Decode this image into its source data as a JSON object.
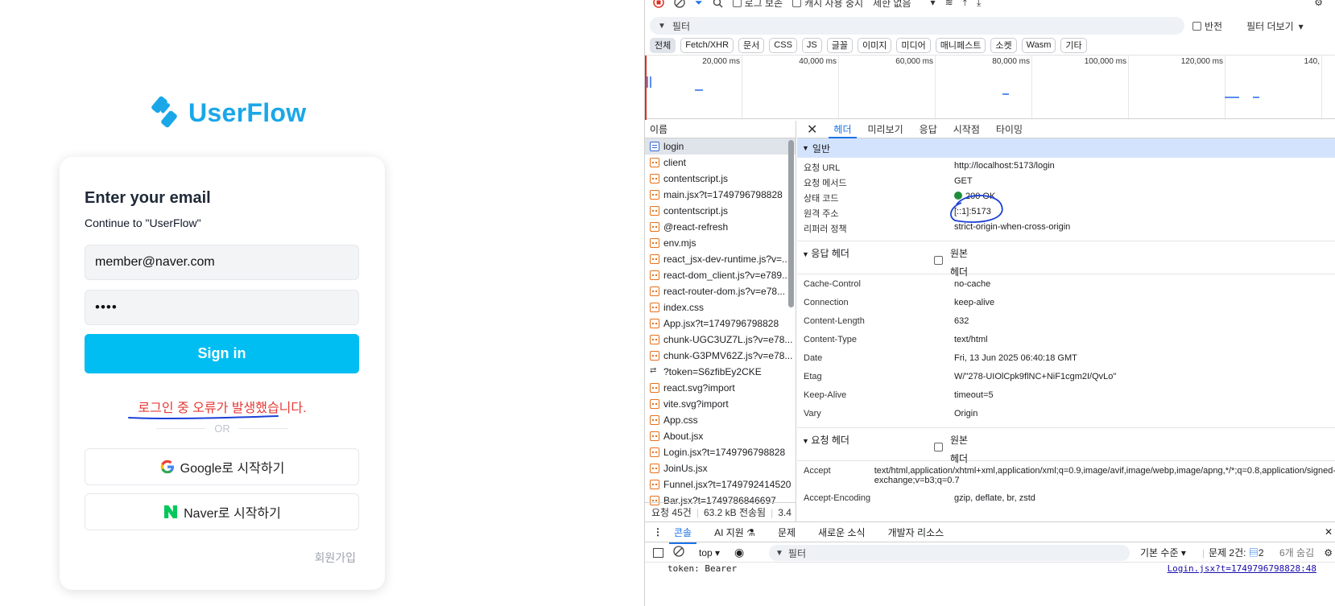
{
  "app": {
    "brand": "UserFlow",
    "title": "Enter your email",
    "subtitle": "Continue to \"UserFlow\"",
    "email_value": "member@naver.com",
    "password_mask": "••••",
    "signin_label": "Sign in",
    "error_message": "로그인 중 오류가 발생했습니다.",
    "or_label": "OR",
    "google_label": "Google로 시작하기",
    "naver_label": "Naver로 시작하기",
    "signup_label": "회원가입",
    "colors": {
      "brand": "#1aa7e8",
      "primary_button": "#00bdf2",
      "error": "#e53935",
      "naver": "#03c75a"
    }
  },
  "devtools": {
    "toolbar1": {
      "preserve_log": "로그 보존",
      "disable_cache": "캐시 사용 중지",
      "throttle": "제한 없음"
    },
    "filter_placeholder": "필터",
    "invert": "반전",
    "more_filters": "필터 더보기",
    "type_filters": [
      "전체",
      "Fetch/XHR",
      "문서",
      "CSS",
      "JS",
      "글꼴",
      "이미지",
      "미디어",
      "매니페스트",
      "소켓",
      "Wasm",
      "기타"
    ],
    "timeline_ticks": [
      "20,000 ms",
      "40,000 ms",
      "60,000 ms",
      "80,000 ms",
      "100,000 ms",
      "120,000 ms",
      "140,"
    ],
    "name_header": "이름",
    "requests": [
      {
        "name": "login",
        "type": "doc"
      },
      {
        "name": "client",
        "type": "script"
      },
      {
        "name": "contentscript.js",
        "type": "script"
      },
      {
        "name": "main.jsx?t=1749796798828",
        "type": "script"
      },
      {
        "name": "contentscript.js",
        "type": "script"
      },
      {
        "name": "@react-refresh",
        "type": "script"
      },
      {
        "name": "env.mjs",
        "type": "script"
      },
      {
        "name": "react_jsx-dev-runtime.js?v=...",
        "type": "script"
      },
      {
        "name": "react-dom_client.js?v=e789...",
        "type": "script"
      },
      {
        "name": "react-router-dom.js?v=e78...",
        "type": "script"
      },
      {
        "name": "index.css",
        "type": "script"
      },
      {
        "name": "App.jsx?t=1749796798828",
        "type": "script"
      },
      {
        "name": "chunk-UGC3UZ7L.js?v=e78...",
        "type": "script"
      },
      {
        "name": "chunk-G3PMV62Z.js?v=e78...",
        "type": "script"
      },
      {
        "name": "?token=S6zfibEy2CKE",
        "type": "ws"
      },
      {
        "name": "react.svg?import",
        "type": "script"
      },
      {
        "name": "vite.svg?import",
        "type": "script"
      },
      {
        "name": "App.css",
        "type": "script"
      },
      {
        "name": "About.jsx",
        "type": "script"
      },
      {
        "name": "Login.jsx?t=1749796798828",
        "type": "script"
      },
      {
        "name": "JoinUs.jsx",
        "type": "script"
      },
      {
        "name": "Funnel.jsx?t=1749792414520",
        "type": "script"
      },
      {
        "name": "Bar.jsx?t=1749786846697",
        "type": "script"
      }
    ],
    "status_bar": {
      "requests": "요청 45건",
      "transferred": "63.2 kB 전송됨",
      "resources": "3.4"
    },
    "detail_tabs": [
      "헤더",
      "미리보기",
      "응답",
      "시작점",
      "타이밍"
    ],
    "general_title": "일반",
    "general": [
      {
        "k": "요청 URL",
        "v": "http://localhost:5173/login"
      },
      {
        "k": "요청 메서드",
        "v": "GET"
      },
      {
        "k": "상태 코드",
        "v": "200 OK"
      },
      {
        "k": "원격 주소",
        "v": "[::1]:5173"
      },
      {
        "k": "리퍼러 정책",
        "v": "strict-origin-when-cross-origin"
      }
    ],
    "response_headers_title": "응답 헤더",
    "raw_label_1": "원본",
    "raw_label_2": "헤더",
    "response_headers": [
      {
        "k": "Cache-Control",
        "v": "no-cache"
      },
      {
        "k": "Connection",
        "v": "keep-alive"
      },
      {
        "k": "Content-Length",
        "v": "632"
      },
      {
        "k": "Content-Type",
        "v": "text/html"
      },
      {
        "k": "Date",
        "v": "Fri, 13 Jun 2025 06:40:18 GMT"
      },
      {
        "k": "Etag",
        "v": "W/\"278-UIOlCpk9flNC+NiF1cgm2I/QvLo\""
      },
      {
        "k": "Keep-Alive",
        "v": "timeout=5"
      },
      {
        "k": "Vary",
        "v": "Origin"
      }
    ],
    "request_headers_title": "요청 헤더",
    "request_headers": [
      {
        "k": "Accept",
        "v": "text/html,application/xhtml+xml,application/xml;q=0.9,image/avif,image/webp,image/apng,*/*;q=0.8,application/signed-exchange;v=b3;q=0.7"
      },
      {
        "k": "Accept-Encoding",
        "v": "gzip, deflate, br, zstd"
      }
    ],
    "drawer_tabs": [
      "콘솔",
      "AI 지원 ⚗",
      "문제",
      "새로운 소식",
      "개발자 리소스"
    ],
    "console": {
      "context": "top",
      "filter_placeholder": "필터",
      "level": "기본 수준",
      "issues": "문제 2건:",
      "issues_count": "2",
      "hidden": "6개 숨김",
      "log_text": "token: Bearer",
      "log_source": "Login.jsx?t=1749796798828:48"
    },
    "colors": {
      "status_ok": "#1e8e3e",
      "accent": "#1a73e8",
      "selected_row": "#dfe3ea",
      "section": "#d3e3fd"
    }
  }
}
